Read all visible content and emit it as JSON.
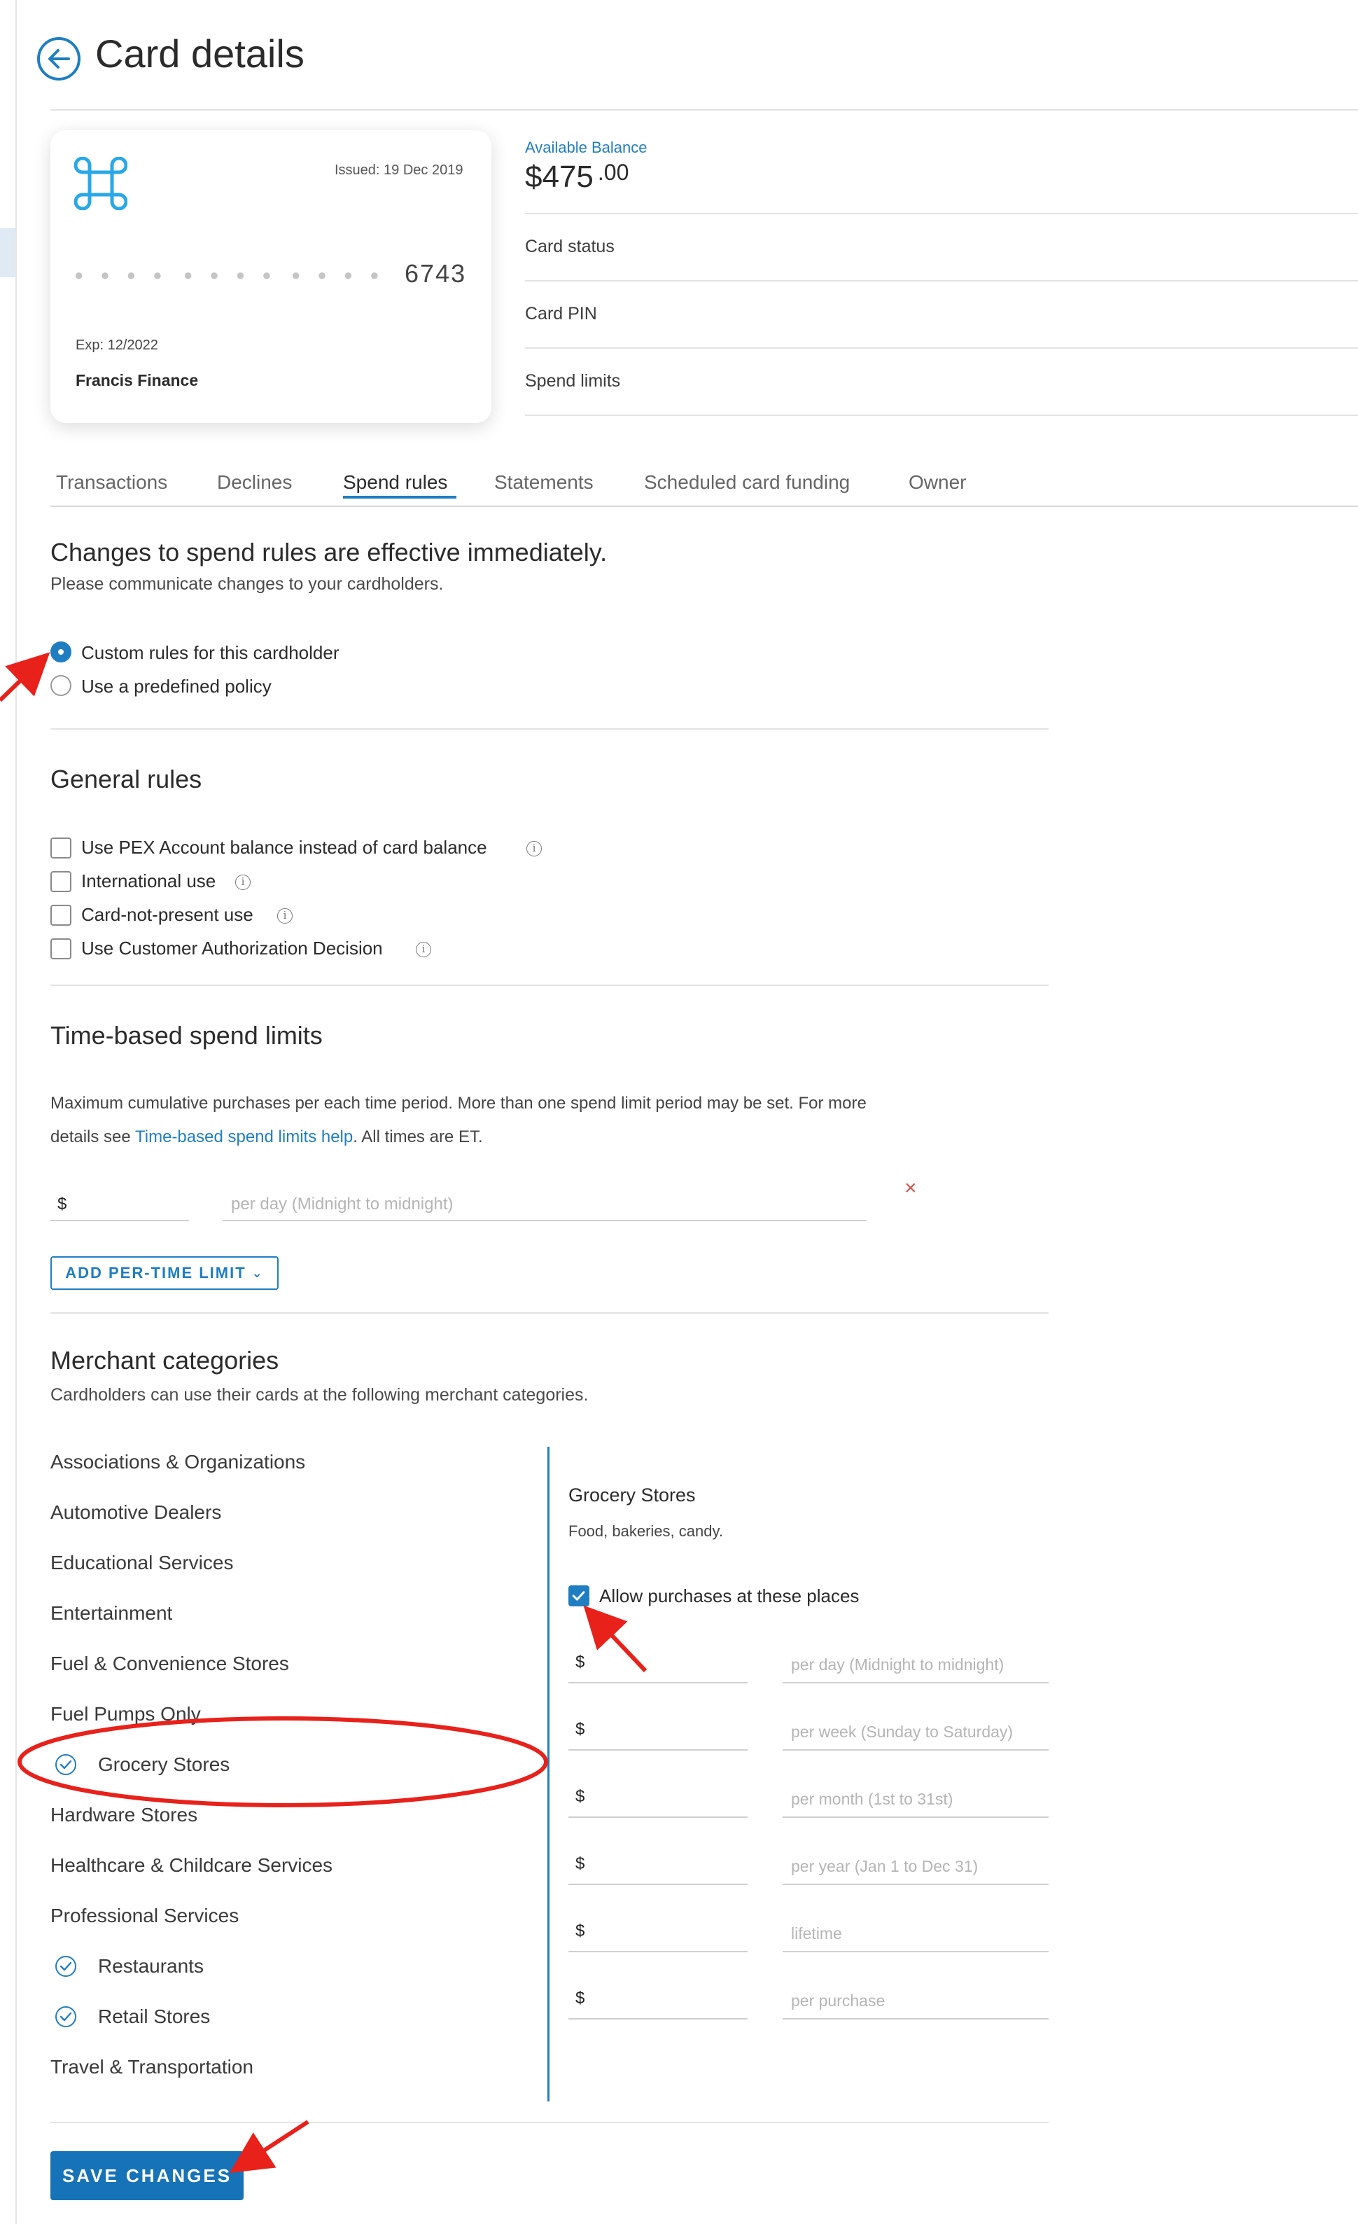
{
  "header": {
    "title": "Card details"
  },
  "card": {
    "issued": "Issued: 19 Dec 2019",
    "masked_group": "● ● ● ●",
    "last4": "6743",
    "exp": "Exp: 12/2022",
    "holder": "Francis Finance"
  },
  "summary": {
    "available_label": "Available Balance",
    "balance_main": "$475",
    "balance_cents": ".00",
    "items": [
      "Card status",
      "Card PIN",
      "Spend limits"
    ]
  },
  "tabs": [
    "Transactions",
    "Declines",
    "Spend rules",
    "Statements",
    "Scheduled card funding",
    "Owner"
  ],
  "active_tab": "Spend rules",
  "spend_rules": {
    "heading": "Changes to spend rules are effective immediately.",
    "subheading": "Please communicate changes to your cardholders.",
    "options": [
      {
        "label": "Custom rules for this cardholder",
        "selected": true
      },
      {
        "label": "Use a predefined policy",
        "selected": false
      }
    ]
  },
  "general_rules": {
    "heading": "General rules",
    "items": [
      {
        "label": "Use PEX Account balance instead of card balance",
        "checked": false
      },
      {
        "label": "International use",
        "checked": false
      },
      {
        "label": "Card-not-present use",
        "checked": false
      },
      {
        "label": "Use Customer Authorization Decision",
        "checked": false
      }
    ],
    "info_glyph": "i"
  },
  "time_limits": {
    "heading": "Time-based spend limits",
    "desc_line1": "Maximum cumulative purchases per each time period. More than one spend limit period may be set. For more",
    "desc_line2_pre": "details see ",
    "desc_link": "Time-based spend limits help",
    "desc_line2_post": ". All times are ET.",
    "currency": "$",
    "period_placeholder": "per day (Midnight to midnight)",
    "remove": "×",
    "add_button": "ADD PER-TIME LIMIT",
    "add_chevron": "⌄"
  },
  "merchant": {
    "heading": "Merchant categories",
    "subheading": "Cardholders can use their cards at the following merchant categories.",
    "categories": [
      {
        "label": "Associations & Organizations",
        "checked": false
      },
      {
        "label": "Automotive Dealers",
        "checked": false
      },
      {
        "label": "Educational Services",
        "checked": false
      },
      {
        "label": "Entertainment",
        "checked": false
      },
      {
        "label": "Fuel & Convenience Stores",
        "checked": false
      },
      {
        "label": "Fuel Pumps Only",
        "checked": false
      },
      {
        "label": "Grocery Stores",
        "checked": true
      },
      {
        "label": "Hardware Stores",
        "checked": false
      },
      {
        "label": "Healthcare & Childcare Services",
        "checked": false
      },
      {
        "label": "Professional Services",
        "checked": false
      },
      {
        "label": "Restaurants",
        "checked": true
      },
      {
        "label": "Retail Stores",
        "checked": true
      },
      {
        "label": "Travel & Transportation",
        "checked": false
      }
    ],
    "detail": {
      "title": "Grocery Stores",
      "subtitle": "Food, bakeries, candy.",
      "allow_label": "Allow purchases at these places",
      "allow_checked": true,
      "currency": "$",
      "limits": [
        "per day (Midnight to midnight)",
        "per week (Sunday to Saturday)",
        "per month (1st to 31st)",
        "per year (Jan 1 to Dec 31)",
        "lifetime",
        "per purchase"
      ]
    }
  },
  "save_button": "SAVE CHANGES",
  "colors": {
    "accent": "#1f7ec2",
    "button": "#1673b8",
    "annotation": "#e8211b",
    "remove": "#d9534f"
  }
}
